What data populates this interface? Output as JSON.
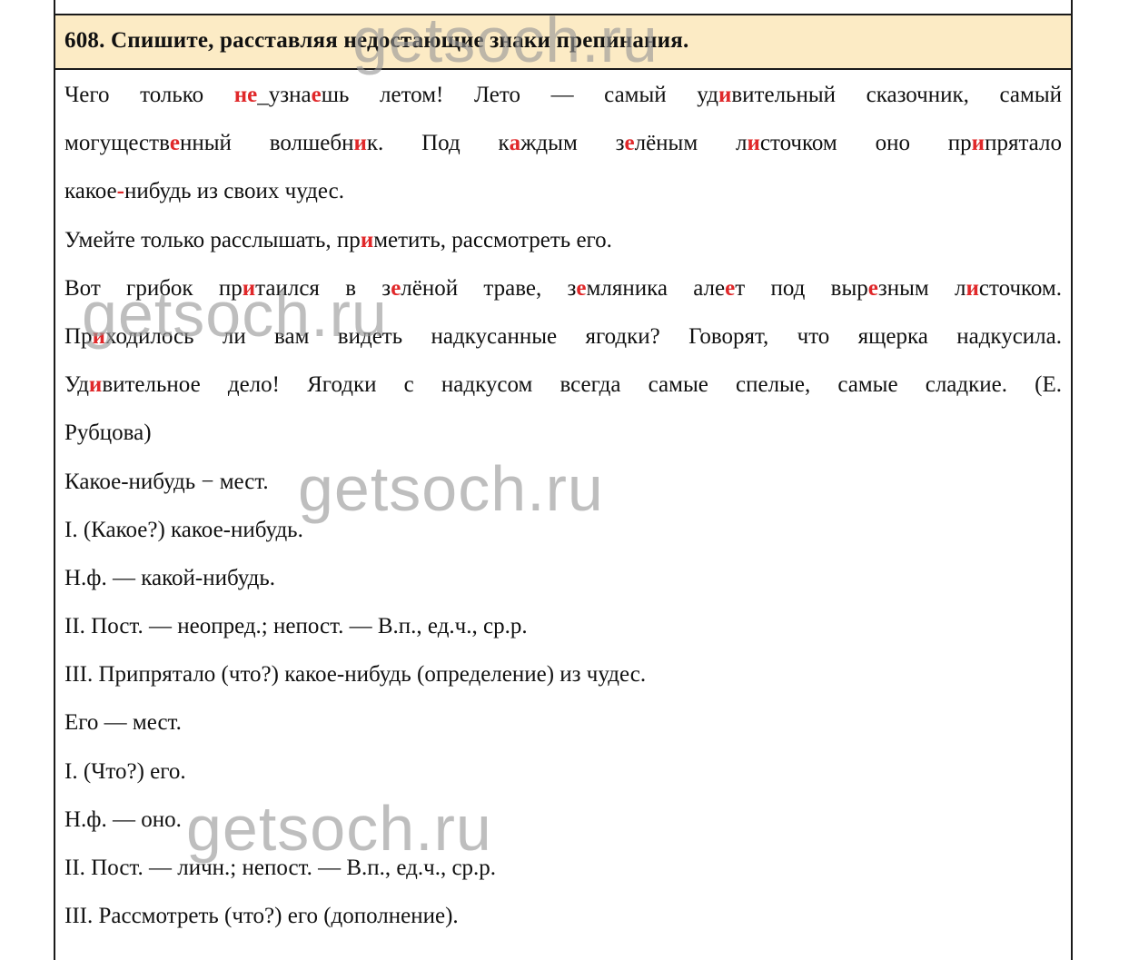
{
  "header": {
    "title": "608. Спишите, расставляя недостающие знаки препинания."
  },
  "watermark": {
    "text": "getsoch.ru"
  },
  "colors": {
    "highlight": "#e0282a",
    "header_bg": "#fcebc5"
  },
  "lines": [
    {
      "justify": true,
      "segments": [
        {
          "t": "Чего только "
        },
        {
          "t": "не",
          "h": true
        },
        {
          "t": "_узна"
        },
        {
          "t": "е",
          "h": true
        },
        {
          "t": "шь летом! Лето — самый уд"
        },
        {
          "t": "и",
          "h": true
        },
        {
          "t": "вительный сказочник, самый"
        }
      ]
    },
    {
      "justify": true,
      "segments": [
        {
          "t": "могуществ"
        },
        {
          "t": "е",
          "h": true
        },
        {
          "t": "нный волшебн"
        },
        {
          "t": "и",
          "h": true
        },
        {
          "t": "к. Под к"
        },
        {
          "t": "а",
          "h": true
        },
        {
          "t": "ждым з"
        },
        {
          "t": "е",
          "h": true
        },
        {
          "t": "лёным л"
        },
        {
          "t": "и",
          "h": true
        },
        {
          "t": "сточком оно пр"
        },
        {
          "t": "и",
          "h": true
        },
        {
          "t": "прятало"
        }
      ]
    },
    {
      "justify": false,
      "segments": [
        {
          "t": "какое"
        },
        {
          "t": "-",
          "h": true
        },
        {
          "t": "нибудь из своих чудес."
        }
      ]
    },
    {
      "justify": false,
      "segments": [
        {
          "t": "Умейте только расслышать, пр"
        },
        {
          "t": "и",
          "h": true
        },
        {
          "t": "метить, рассмотреть его."
        }
      ]
    },
    {
      "justify": true,
      "segments": [
        {
          "t": "Вот грибок пр"
        },
        {
          "t": "и",
          "h": true
        },
        {
          "t": "таился в з"
        },
        {
          "t": "е",
          "h": true
        },
        {
          "t": "лёной траве, з"
        },
        {
          "t": "е",
          "h": true
        },
        {
          "t": "мляника але"
        },
        {
          "t": "е",
          "h": true
        },
        {
          "t": "т под выр"
        },
        {
          "t": "е",
          "h": true
        },
        {
          "t": "зным л"
        },
        {
          "t": "и",
          "h": true
        },
        {
          "t": "сточком."
        }
      ]
    },
    {
      "justify": true,
      "segments": [
        {
          "t": "Пр"
        },
        {
          "t": "и",
          "h": true
        },
        {
          "t": "ходилось ли вам видеть надкусанные ягодки? Говорят, что ящерка надкусила."
        }
      ]
    },
    {
      "justify": true,
      "segments": [
        {
          "t": "Уд"
        },
        {
          "t": "и",
          "h": true
        },
        {
          "t": "вительное дело! Ягодки с надкусом всегда самые спелые, самые сладкие. (Е."
        }
      ]
    },
    {
      "justify": false,
      "segments": [
        {
          "t": "Рубцова)"
        }
      ]
    },
    {
      "justify": false,
      "segments": [
        {
          "t": "Какое-нибудь − мест."
        }
      ]
    },
    {
      "justify": false,
      "segments": [
        {
          "t": "I. (Какое?) какое-нибудь."
        }
      ]
    },
    {
      "justify": false,
      "segments": [
        {
          "t": "Н.ф. — какой-нибудь."
        }
      ]
    },
    {
      "justify": false,
      "segments": [
        {
          "t": "II. Пост. — неопред.; непост. — В.п., ед.ч., ср.р."
        }
      ]
    },
    {
      "justify": false,
      "segments": [
        {
          "t": "III. Припрятало (что?) какое-нибудь (определение) из чудес."
        }
      ]
    },
    {
      "justify": false,
      "segments": [
        {
          "t": "Его — мест."
        }
      ]
    },
    {
      "justify": false,
      "segments": [
        {
          "t": "I. (Что?) его."
        }
      ]
    },
    {
      "justify": false,
      "segments": [
        {
          "t": "Н.ф. — оно."
        }
      ]
    },
    {
      "justify": false,
      "segments": [
        {
          "t": "II. Пост. — личн.; непост. — В.п., ед.ч., ср.р."
        }
      ]
    },
    {
      "justify": false,
      "segments": [
        {
          "t": "III. Рассмотреть (что?) его (дополнение)."
        }
      ]
    }
  ]
}
